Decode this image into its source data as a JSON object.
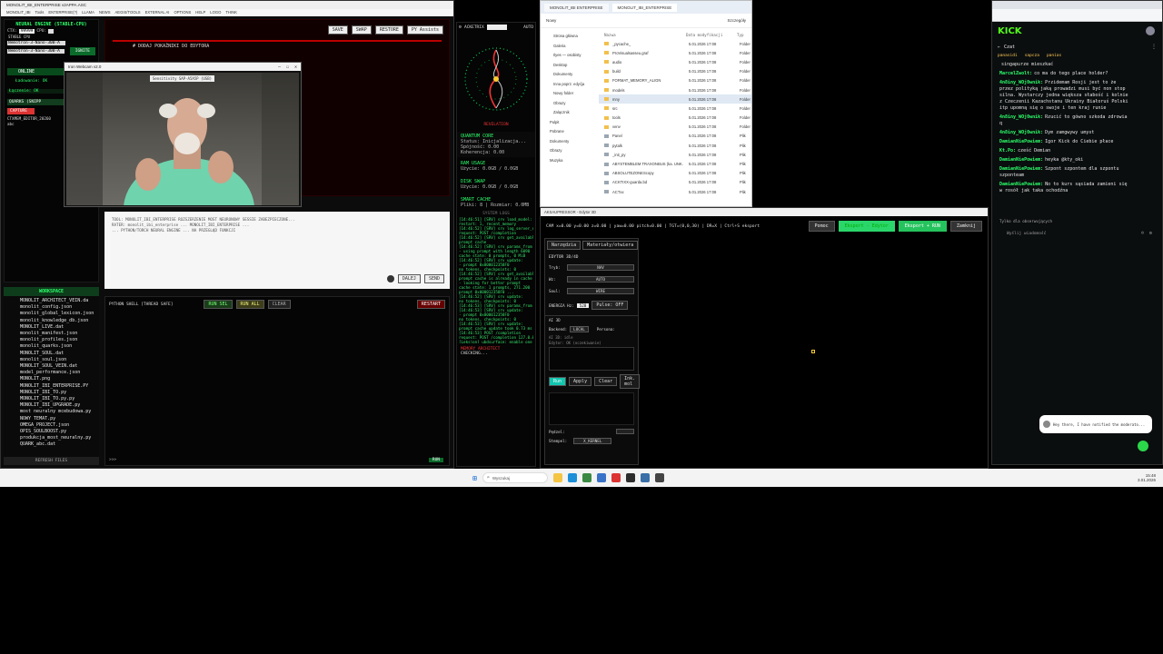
{
  "desktop": {
    "accent": "#00ff66"
  },
  "main_window": {
    "title": "MONOLIT_IBI_ENTERPRISE v2APPA.ASC",
    "menu": [
      "MONOLIT_IBI",
      "Tools",
      "ENTERPRISE(?)",
      "LLAMA",
      "NEWS",
      "AEGIS/TOOLS",
      "EXTERNAL AI",
      "OPTIONS",
      "HELP",
      "LOGO",
      "THINK"
    ],
    "engine_title": "NEURAL ENGINE (STABLE-CPU)",
    "engine_fields": [
      "CTX:",
      "99999",
      "CPU:"
    ],
    "stable_label": "STABLE CPU",
    "model_names": [
      "Nemotron-3-Nano-30B-A",
      "Nemotron-3-Nano-30B-A"
    ],
    "ignite": "IGNITE",
    "online": "ONLINE",
    "loading": "Ładowanie: OK",
    "connected": "Łączenie: OK",
    "quarks": "QUARKS (SNIPP",
    "capture": "CAPTURE",
    "ctx_editor": "CTXMEM_EDITOR_20260",
    "abc": "abc",
    "workspace": "WORKSPACE",
    "files": [
      "MONOLIT_ARCHITECT_VEIN.da",
      "monolit_config.json",
      "monolit_global_lexicon.json",
      "monolit_knowledge_db.json",
      "MONOLIT_LIVE.dat",
      "monolit_manifest.json",
      "monolit_profiles.json",
      "monolit_quarks.json",
      "MONOLIT_SOUL.dat",
      "monolit_soul.json",
      "MONOLIT_SOUL_VEIN.dat",
      "model_performance.json",
      "MONOLIT.png",
      "MONOLIT_IBI_ENTERPRISE.PY",
      "MONOLIT_IBI_TO.py",
      "MONOLIT_IBI_TO.py.py",
      "MONOLIT_IBI_UPGRADE.py",
      "most neuralny mcebudowa.py",
      "NOWY TEMAT.py",
      "OMEGA_PROJECT.json",
      "OPIS_SOULBOOST.py",
      "produkcja_most_neuralny.py",
      "QUARK_abc.dat"
    ],
    "refresh": "REFRESH FILES",
    "editor_buttons": [
      "SAVE",
      "SWAP",
      "RESTORE",
      "PY Assists"
    ],
    "editor_line": "# DODAJ POKAŻNIKI DO EDYTORA",
    "chat_text": "TOOL: MONOLIT_IBI_ENTERPRISE ROZSZERZENIE MOST NEURONOWY SESSIE ZABEZPIECZONE...\nRATER: monolit_ibi_enterprise ... MONOLIT_IBI_ENTERPRISE ...\n... PYTHON/TORCH NEURAL ENGINE ... NA PRZEGLĄD FUNKCJI",
    "chat_buttons": [
      "DALEJ",
      "SEND"
    ],
    "shell_title": "PYTHON SHELL [THREAD SAFE]",
    "shell_buttons": [
      "RUN SEL",
      "RUN ALL",
      "CLEAR"
    ],
    "restart": "RESTART",
    "run": "RUN",
    "prompt": ">>>"
  },
  "webcam": {
    "title": "Iron Webcam v2.0",
    "dropdown": "Sensitivity SAP-A5A5P (USB)"
  },
  "monitor": {
    "title": "ACKETRIX",
    "auto": "AUTO",
    "revelation": "REVELATION",
    "quantum_title": "QUANTUM CORE",
    "quantum_lines": [
      "Status: Inicjalizacja...",
      "Spójność: 0.00",
      "Koherencja: 0.00"
    ],
    "ram_title": "RAM USAGE",
    "ram_value": "Użycie: 0.0GB / 0.0GB",
    "disk_title": "DISK SWAP",
    "disk_value": "Użycie: 0.0GB / 0.0GB",
    "cache_title": "SMART CACHE",
    "cache_value": "Pliki: 8 | Rozmiar: 0.0MB",
    "logs_title": "SYSTEM LOGS",
    "logs": [
      "[14:46:51] [SRV] srv  load_model: loaded",
      "   restart: 1, recent_memory",
      "[14:46:52] [SRV] srv  log_server_r",
      "   request: POST /completion",
      "[14:46:52] [SRV] srv  get_availabl",
      "   prompt cache",
      "[14:46:52] [SRV] srv  params_from",
      "   - using prompt with length 6090",
      "   cache state: 0 prompts, 0 MiB",
      "[14:46:52] [SRV] srv  update:",
      "   - prompt 0x000012358F0",
      "   no tokens, checkpoints: 0",
      "[14:46:52] [SRV] srv  get_availabl",
      "   prompt cache is already in cache",
      "   - looking for better prompt",
      "   cache state: 1 prompts, 271.200",
      "   prompt 0x000012358F0 ...",
      "[14:46:52] [SRV] srv  update:",
      "   no tokens, checkpoints: 0",
      "[14:46:53] [SRV] srv  params_from",
      "[14:46:53] [SRV] srv  update:",
      "   - prompt 0x000012358F0",
      "   no tokens, checkpoints: 0",
      "[14:46:53] [SRV] srv  update:",
      "   prompt cache update took 0.73 ms",
      "[14:46:53] POST /completion",
      "   request: POST /completion 127.0.0.1",
      "[Leksjon] ubdsurface: enable one"
    ],
    "memory_title": "MEMORY ARCHITECT",
    "checking": "CHECKING..."
  },
  "explorer": {
    "tabs": [
      "MONOLIT_IBI ENTERPRISE",
      "MONOLIT_IBI_ENTERPRISE"
    ],
    "nav": [
      "Nowy",
      "Szczegóły"
    ],
    "sidebar": [
      "Strona główna",
      "Galeria",
      "Ilyes — osobisty",
      "Desktop",
      "Dokumenty",
      "Inna poprz. edyćja",
      "Nowy folder",
      "Obrazy",
      "Zalącznik",
      "Pulpit",
      "Pobrane",
      "Dokumenty",
      "Obrazy",
      "Muzyka"
    ],
    "columns": [
      "Nazwa",
      "Data modyfikacji",
      "Typ"
    ],
    "rows": [
      [
        "_pycache_",
        "5.01.2026 17:08",
        "Folder"
      ],
      [
        "ProVisualsasseu.graf",
        "5.01.2026 17:08",
        "Folder"
      ],
      [
        "audio",
        "5.01.2026 17:08",
        "Folder"
      ],
      [
        "build",
        "5.01.2026 17:08",
        "Folder"
      ],
      [
        "FORMAT_MEMORY_ALIGN",
        "5.01.2026 17:08",
        "Folder"
      ],
      [
        "models",
        "5.01.2026 17:08",
        "Folder"
      ],
      [
        "mny",
        "5.01.2026 17:08",
        "Folder"
      ],
      [
        "src",
        "5.01.2026 17:08",
        "Folder"
      ],
      [
        "tools",
        "5.01.2026 17:08",
        "Folder"
      ],
      [
        "venv",
        "5.01.2026 17:08",
        "Folder"
      ],
      [
        "Panel",
        "5.01.2026 17:08",
        "Plik"
      ],
      [
        "pytalk",
        "5.01.2026 17:08",
        "Plik"
      ],
      [
        "_init_py",
        "5.01.2026 17:08",
        "Plik"
      ],
      [
        "ABYSTEMBLEM TRAXONBUS (ka. UNK.",
        "5.01.2026 17:08",
        "Plik"
      ],
      [
        "ABSOLUTEZONEScopy",
        "5.01.2026 17:08",
        "Plik"
      ],
      [
        "ACKTIXX-guarda.bd",
        "5.01.2026 17:08",
        "Plik"
      ],
      [
        "ACTxx",
        "5.01.2026 17:08",
        "Plik"
      ]
    ]
  },
  "editor3d": {
    "title": "AKSAUPRESSOR - Edytor 3D",
    "status": "CAM x=0.00 y=0.00 z=0.00 | yaw=0.00 pitch=0.00 | TGT=(0,0,30) | DR=X | Ctrl+S eksport",
    "buttons": [
      "Pomoc",
      "Eksport - Edytor",
      "Eksport + RUN",
      "Zamknij"
    ],
    "tabs": [
      "Narzędzia",
      "Materiały/otwiera"
    ],
    "panel_title": "EDYTOR 3D/4D",
    "fields": [
      [
        "Tryb:",
        "NAV"
      ],
      [
        "Wz:",
        "AUTO"
      ],
      [
        "Soul:",
        "WIRE"
      ]
    ],
    "energy_label": "ENERGIA Hz:",
    "energy_value": "528",
    "pulse": "Pulse: OFF",
    "ai_label": "AI 3D",
    "backend_label": "Backend:",
    "backend_value": "LOCAL",
    "persona": "Persona:",
    "ai_lines": [
      "AI 3D: idle",
      "Edytor: OK (oczekiwanie)"
    ],
    "action_buttons": [
      "Run",
      "Apply",
      "Clear",
      "Ink. mol"
    ],
    "footer": [
      [
        "Pędzel:",
        ""
      ],
      [
        "Stempel:",
        "X_KERNEL"
      ]
    ]
  },
  "kick": {
    "logo": "KICK",
    "chat_title": "Czat",
    "pinned": [
      "panasidi",
      "sapcza",
      "panias"
    ],
    "messages": [
      [
        "",
        "singapurze mieszkać"
      ],
      [
        "MarcelZwolt:",
        "co ma do tego place holder?"
      ],
      [
        "4n8iny_WOj0wnik:",
        "Przidemam Rosji jest to że przez polityką jaką prowadzi musi być non stop silna. Wystarczy jedna większa słabość i kolnie z Czeczenii Kazachstanu Ukrainy Białoruś Polski itp upomną się o swoje i ten kraj runie"
      ],
      [
        "4n8iny_WOj0wnik:",
        "Rzucić to gówno szkoda zdrowia q"
      ],
      [
        "4n8iny_WOj0wnik:",
        "Dym zamgwywy umyst"
      ],
      [
        "DamianNiePowiem:",
        "Igor Kick do Ciebie płace"
      ],
      [
        "Kt.Po:",
        "cześć Demian"
      ],
      [
        "DamianNiePowiem:",
        "heyka @kty_oki"
      ],
      [
        "DamianNiePowiem:",
        "Szpont szpontem dla szpontu szponteam"
      ],
      [
        "DamianNiePowiem:",
        "No to kurs sąsiada zamieni się w rosół jak taka ochodźna"
      ]
    ],
    "follower_note": "Tylko dla obserwujących",
    "input_placeholder": "Wyślij wiadomość",
    "toast": "Hey there, I have notified the moderato..."
  },
  "taskbar": {
    "search": "Wyszukaj",
    "time": "15:48",
    "date": "3.01.2026"
  }
}
